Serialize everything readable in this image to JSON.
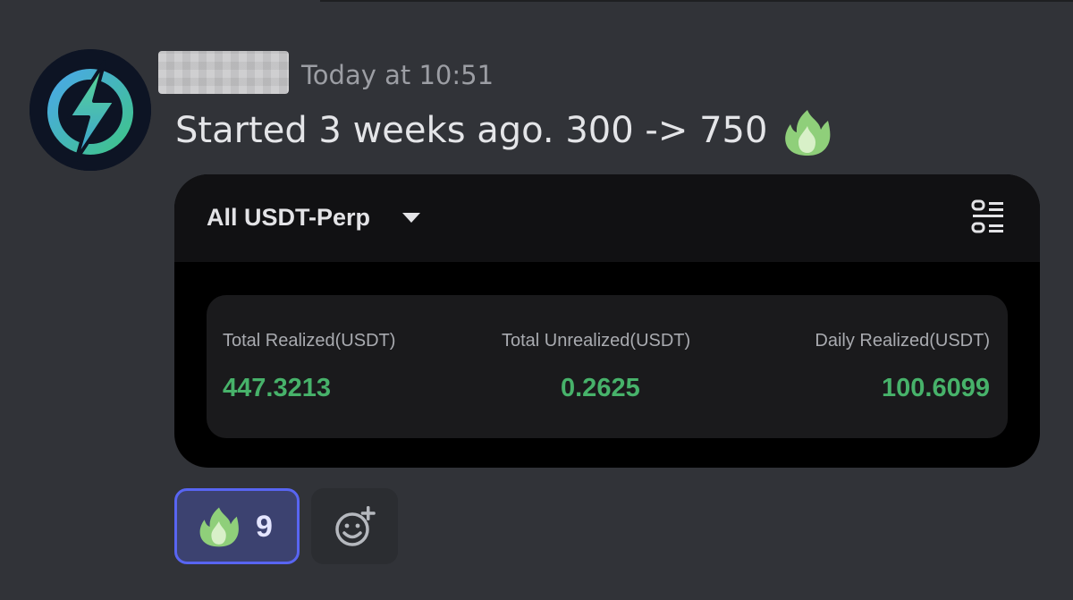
{
  "message": {
    "username_redacted": true,
    "timestamp": "Today at 10:51",
    "text": "Started 3 weeks ago. 300 -> 750",
    "inline_emoji": "fire-emoji"
  },
  "embed": {
    "title": "All USDT-Perp",
    "stats": [
      {
        "label": "Total Realized(USDT)",
        "value": "447.3213"
      },
      {
        "label": "Total Unrealized(USDT)",
        "value": "0.2625"
      },
      {
        "label": "Daily Realized(USDT)",
        "value": "100.6099"
      }
    ],
    "value_color": "#47b26a"
  },
  "reactions": [
    {
      "emoji": "fire-emoji",
      "count": "9",
      "selected": true
    }
  ],
  "colors": {
    "background": "#313338",
    "reaction_selected_border": "#5865f2",
    "reaction_selected_bg": "#3c4270"
  }
}
